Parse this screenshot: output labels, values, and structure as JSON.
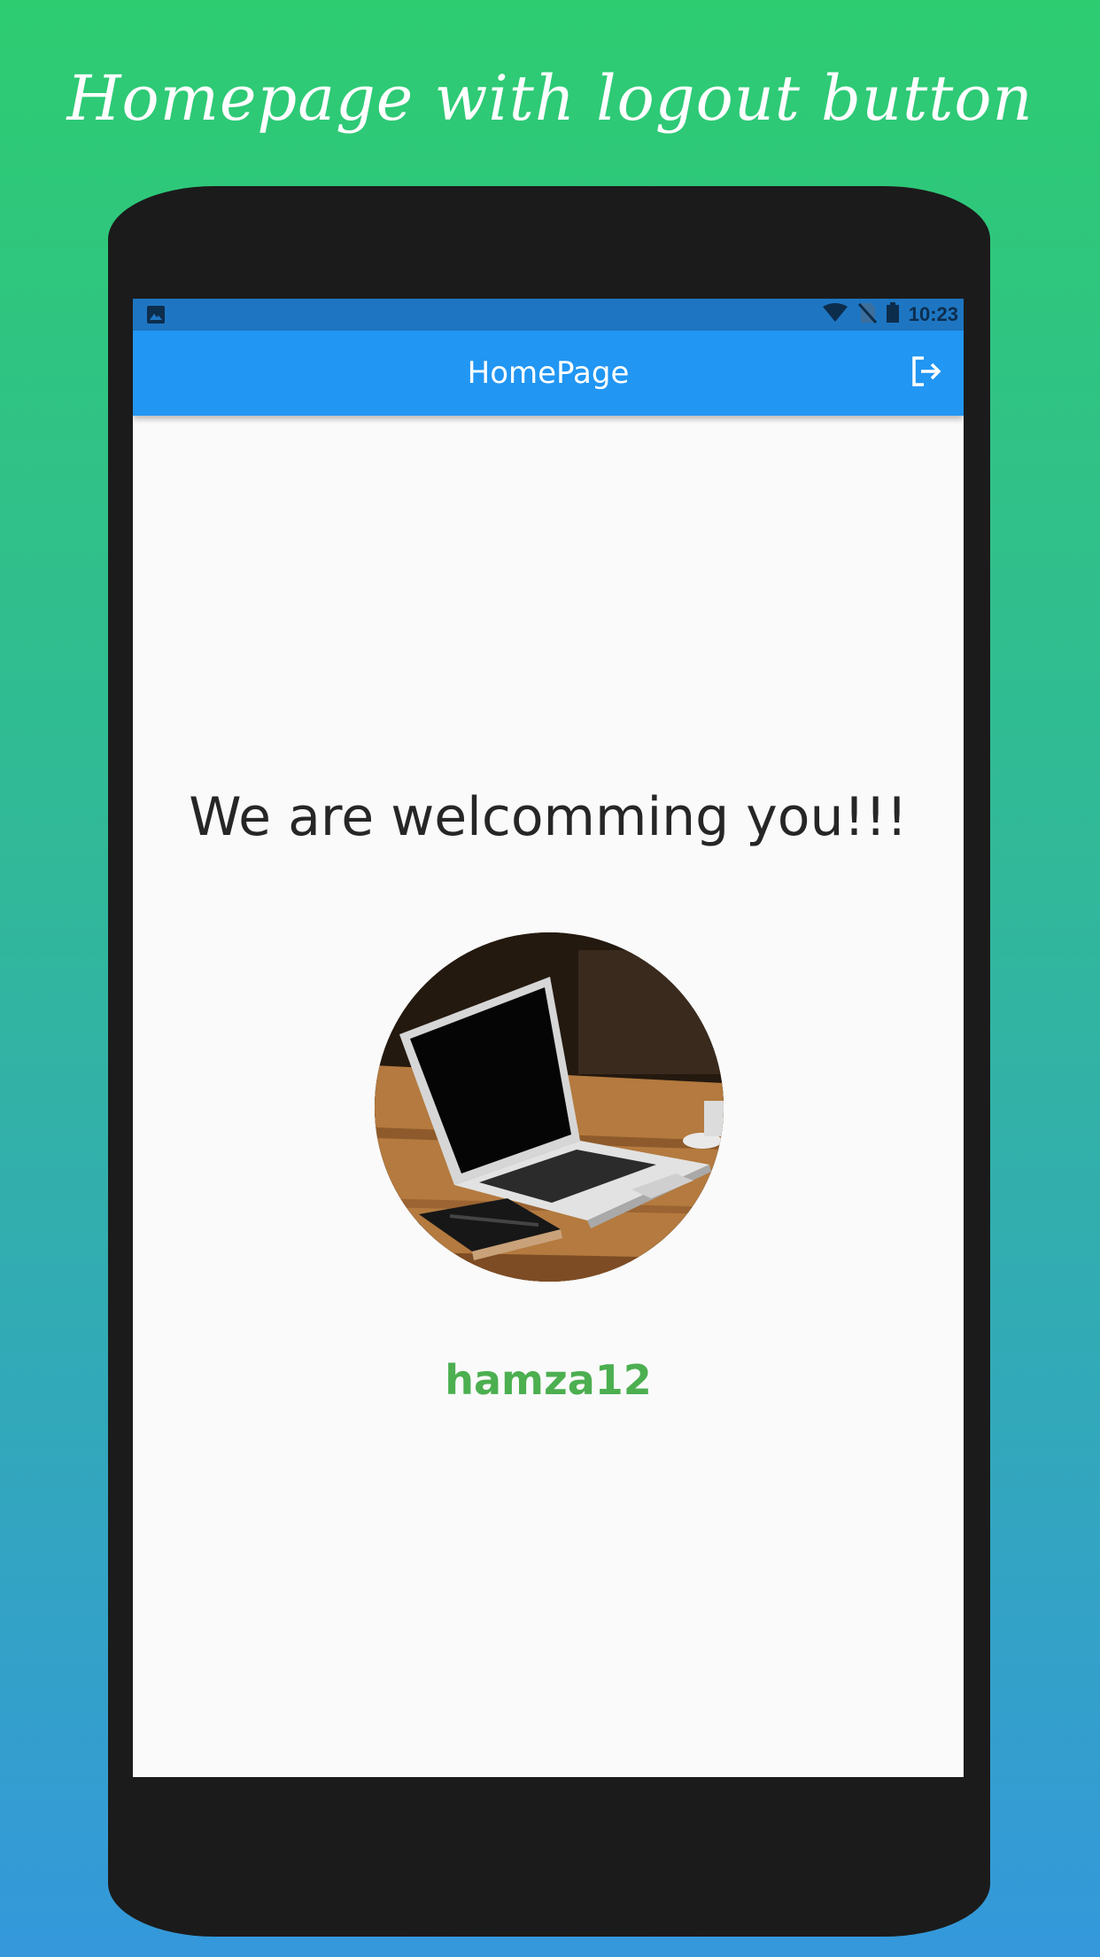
{
  "headline": "Homepage with logout button",
  "status_bar": {
    "time": "10:23",
    "icons": [
      "image-notification-icon",
      "wifi-icon",
      "no-sim-icon",
      "battery-icon"
    ]
  },
  "app_bar": {
    "title": "HomePage",
    "logout_icon": "logout-icon"
  },
  "main": {
    "welcome_text": "We are welcomming you!!!",
    "avatar_icon": "laptop-photo",
    "username": "hamza12"
  },
  "colors": {
    "background_top": "#2ecc71",
    "background_bottom": "#3498db",
    "app_bar": "#2196f3",
    "status_bar": "#1e76c2",
    "username": "#4caf50",
    "phone": "#1b1b1b"
  }
}
